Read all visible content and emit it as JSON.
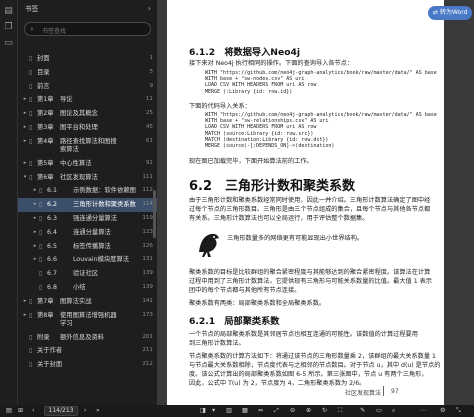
{
  "sidebar": {
    "title": "书签",
    "search_placeholder": "书签查找",
    "items": [
      {
        "label": "封面",
        "page": "1",
        "chapter": "",
        "level": 0,
        "arrow": ""
      },
      {
        "label": "目录",
        "page": "5",
        "chapter": "",
        "level": 0,
        "arrow": ""
      },
      {
        "label": "前言",
        "page": "9",
        "chapter": "",
        "level": 0,
        "arrow": ""
      },
      {
        "label": "导论",
        "page": "11",
        "chapter": "第1章",
        "level": 0,
        "arrow": "▸"
      },
      {
        "label": "图论及其概念",
        "page": "25",
        "chapter": "第2章",
        "level": 0,
        "arrow": "▸"
      },
      {
        "label": "图平台和处理",
        "page": "45",
        "chapter": "第3章",
        "level": 0,
        "arrow": "▸"
      },
      {
        "label": "路径查找算法和图搜索算法",
        "page": "61",
        "chapter": "第4章",
        "level": 0,
        "arrow": "▸"
      },
      {
        "label": "中心性算法",
        "page": "91",
        "chapter": "第5章",
        "level": 0,
        "arrow": "▸"
      },
      {
        "label": "社区发现算法",
        "page": "111",
        "chapter": "第6章",
        "level": 0,
        "arrow": "▾"
      },
      {
        "label": "示例数据：软件依赖图",
        "page": "112",
        "chapter": "6.1",
        "level": 1,
        "arrow": "▸"
      },
      {
        "label": "三角形计数和聚类系数",
        "page": "114",
        "chapter": "6.2",
        "level": 1,
        "arrow": "▸"
      },
      {
        "label": "强连通分量算法",
        "page": "119",
        "chapter": "6.3",
        "level": 1,
        "arrow": "▸"
      },
      {
        "label": "连通分量算法",
        "page": "123",
        "chapter": "6.4",
        "level": 1,
        "arrow": "▸"
      },
      {
        "label": "标签传播算法",
        "page": "126",
        "chapter": "6.5",
        "level": 1,
        "arrow": "▸"
      },
      {
        "label": "Louvain模块度算法",
        "page": "131",
        "chapter": "6.6",
        "level": 1,
        "arrow": "▸"
      },
      {
        "label": "验证社区",
        "page": "139",
        "chapter": "6.7",
        "level": 1,
        "arrow": ""
      },
      {
        "label": "小结",
        "page": "139",
        "chapter": "6.8",
        "level": 1,
        "arrow": ""
      },
      {
        "label": "图算法实战",
        "page": "141",
        "chapter": "第7章",
        "level": 0,
        "arrow": "▸"
      },
      {
        "label": "使用图算法增强机器学习",
        "page": "173",
        "chapter": "第8章",
        "level": 0,
        "arrow": "▸"
      },
      {
        "label": "额外信息及资料",
        "page": "201",
        "chapter": "附录",
        "level": 0,
        "arrow": ""
      },
      {
        "label": "关于作者",
        "page": "211",
        "chapter": "",
        "level": 0,
        "arrow": ""
      },
      {
        "label": "关于封面",
        "page": "212",
        "chapter": "",
        "level": 0,
        "arrow": ""
      }
    ],
    "active_index": 10
  },
  "translate_button": "转为Word",
  "page": {
    "h3_a": "6.1.2　将数据导入Neo4j",
    "p1": "接下来对 Neo4j 执行相同的操作。下面的查询导入各节点：",
    "code1": "WITH \"https://github.com/neo4j-graph-analytics/book/raw/master/data/\" AS base\nWITH base + \"sw-nodes.csv\" AS uri\nLOAD CSV WITH HEADERS FROM uri AS row\nMERGE (:Library {id: row.id})",
    "p2": "下面的代码导入关系：",
    "code2": "WITH \"https://github.com/neo4j-graph-analytics/book/raw/master/data/\" AS base\nWITH base + \"sw-relationships.csv\" AS uri\nLOAD CSV WITH HEADERS FROM uri AS row\nMATCH (source:Library {id: row.src})\nMATCH (destination:Library {id: row.dst})\nMERGE (source)-[:DEPENDS_ON]->(destination)",
    "p3": "现在图已加载完毕，下面开始算法前的工作。",
    "h2": "6.2　三角形计数和聚类系数",
    "p4_lines": [
      "由于三角形计数和聚类系数经常同时使用，因此一并介绍。三角形计数算法确定了图中经",
      "过每个节点的三角形数目。三角形是由三个节点组成的集合，且每个节点与其他各节点都",
      "有关系。三角形计数算法也可以全局运行，用于评估整个数据集。"
    ],
    "note": "三角形数量多的网络更有可能显现出小世界结构。",
    "p5_lines": [
      "聚类系数的目标是比较群组的聚合紧密程度与其能够达到的聚合紧密程度。该算法在计算",
      "过程中用到了三角形计数算法，它提供现有三角形与可能关系数量的比值。最大值 1 表示",
      "团中的每个节点都与其他所有节点连接。"
    ],
    "p6": "聚类系数有两类：局部聚类系数和全局聚类系数。",
    "h3_b": "6.2.1　局部聚类系数",
    "p7_lines": [
      "一个节点的局部聚类系数是其邻居节点也相互连通的可能性。该数值的计算过程要用",
      "到三角形计数算法。"
    ],
    "p8_lines": [
      "节点聚类系数的计算方法如下：将通过该节点的三角形数量乘 2，该群组的最大关系数量 1",
      "与节点最大关系数相除，节点度代表与之相邻的节点数目。对于节点 u，其中 d(u) 是节点的",
      "度。该公式计算出的局部聚类系数如图 6-5 所示。第三张图中，节点 u 有两个三角形，",
      "因此，公式中 T(u) 为 2，节点度为 4，二角形聚类系数为 2/6。"
    ],
    "footer_left": "社区发现算法",
    "footer_right": "97"
  },
  "bottom": {
    "page_display": "114/213",
    "icons": [
      "sidebar-toggle-icon",
      "thumbnail-icon",
      "first-page-icon",
      "prev-page-icon",
      "next-page-icon",
      "last-page-icon",
      "single-page-icon",
      "double-page-icon",
      "read-mode-icon",
      "zoom-out-icon",
      "zoom-in-icon",
      "fit-width-icon",
      "fit-page-icon",
      "rotate-icon",
      "fullscreen-icon",
      "more-icon"
    ]
  }
}
